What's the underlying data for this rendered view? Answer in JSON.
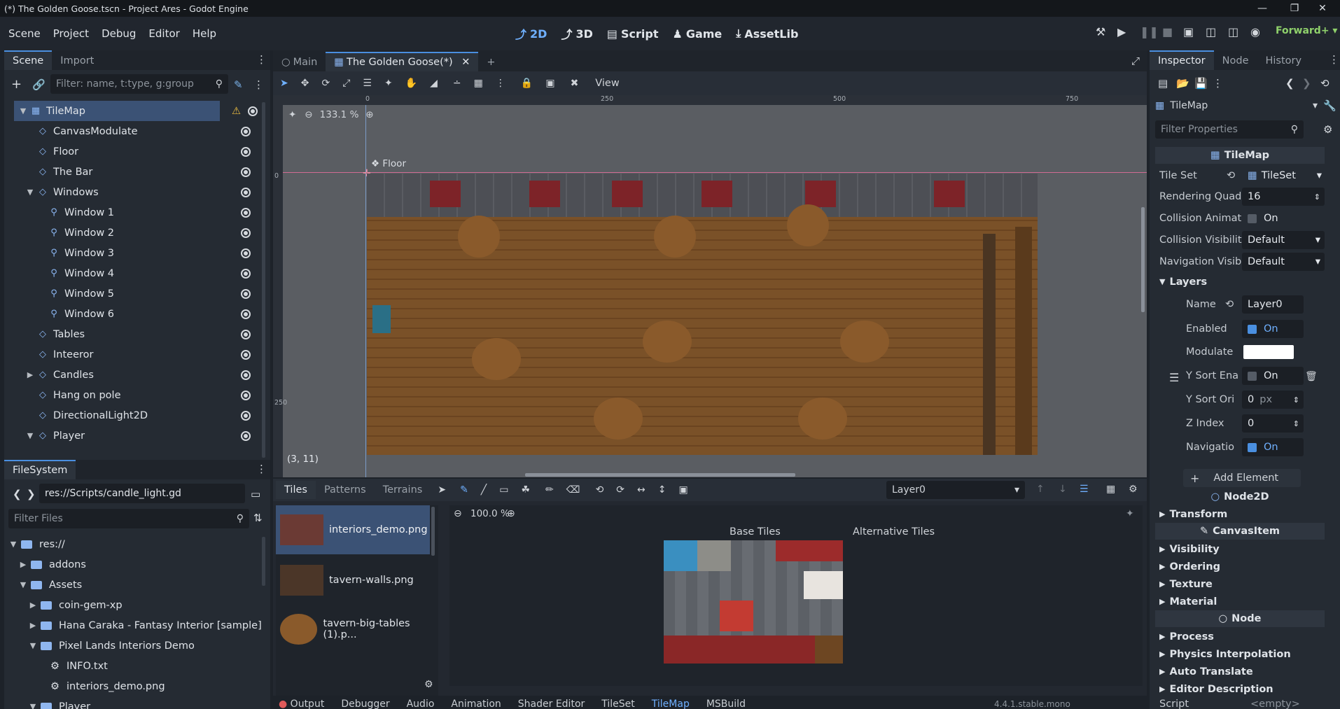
{
  "window": {
    "title": "(*) The Golden Goose.tscn - Project Ares - Godot Engine"
  },
  "menu": {
    "items": [
      "Scene",
      "Project",
      "Debug",
      "Editor",
      "Help"
    ]
  },
  "workspaces": [
    {
      "label": "2D",
      "icon": "2d-icon"
    },
    {
      "label": "3D",
      "icon": "3d-icon"
    },
    {
      "label": "Script",
      "icon": "script-icon"
    },
    {
      "label": "Game",
      "icon": "game-icon"
    },
    {
      "label": "AssetLib",
      "icon": "assetlib-icon"
    }
  ],
  "renderer": "Forward+",
  "scene_dock": {
    "tabs": [
      "Scene",
      "Import"
    ],
    "filter_placeholder": "Filter: name, t:type, g:group",
    "nodes": [
      {
        "label": "TileMap",
        "depth": 0
      },
      {
        "label": "CanvasModulate",
        "depth": 1
      },
      {
        "label": "Floor",
        "depth": 1
      },
      {
        "label": "The Bar",
        "depth": 1
      },
      {
        "label": "Windows",
        "depth": 1
      },
      {
        "label": "Window 1",
        "depth": 2
      },
      {
        "label": "Window 2",
        "depth": 2
      },
      {
        "label": "Window 3",
        "depth": 2
      },
      {
        "label": "Window 4",
        "depth": 2
      },
      {
        "label": "Window 5",
        "depth": 2
      },
      {
        "label": "Window 6",
        "depth": 2
      },
      {
        "label": "Tables",
        "depth": 1
      },
      {
        "label": "Inteeror",
        "depth": 1
      },
      {
        "label": "Candles",
        "depth": 1
      },
      {
        "label": "Hang on pole",
        "depth": 1
      },
      {
        "label": "DirectionalLight2D",
        "depth": 1
      },
      {
        "label": "Player",
        "depth": 1
      }
    ]
  },
  "filesystem": {
    "tab": "FileSystem",
    "path": "res://Scripts/candle_light.gd",
    "filter_placeholder": "Filter Files",
    "items": [
      {
        "label": "res://",
        "depth": 0
      },
      {
        "label": "addons",
        "depth": 1
      },
      {
        "label": "Assets",
        "depth": 1
      },
      {
        "label": "coin-gem-xp",
        "depth": 2
      },
      {
        "label": "Hana Caraka - Fantasy Interior [sample]",
        "depth": 2
      },
      {
        "label": "Pixel Lands Interiors Demo",
        "depth": 2
      },
      {
        "label": "INFO.txt",
        "depth": 3
      },
      {
        "label": "interiors_demo.png",
        "depth": 3
      },
      {
        "label": "Player",
        "depth": 2
      }
    ]
  },
  "editor": {
    "tabs": [
      "Main",
      "The Golden Goose(*)"
    ],
    "view_label": "View",
    "zoom": "133.1 %",
    "ruler": [
      "0",
      "250",
      "500",
      "750"
    ],
    "vruler": [
      "0",
      "250"
    ],
    "floor_label": "Floor",
    "coords": "(3, 11)"
  },
  "tile_panel": {
    "tabs": [
      "Tiles",
      "Patterns",
      "Terrains"
    ],
    "layer": "Layer0",
    "zoom": "100.0 %",
    "sources": [
      "interiors_demo.png",
      "tavern-walls.png",
      "tavern-big-tables (1).p..."
    ],
    "base_label": "Base Tiles",
    "alt_label": "Alternative Tiles"
  },
  "bottom_tabs": [
    "Output",
    "Debugger",
    "Audio",
    "Animation",
    "Shader Editor",
    "TileSet",
    "TileMap",
    "MSBuild"
  ],
  "version": "4.4.1.stable.mono",
  "inspector": {
    "tabs": [
      "Inspector",
      "Node",
      "History"
    ],
    "object": "TileMap",
    "filter_placeholder": "Filter Properties",
    "class_header": "TileMap",
    "tile_set": {
      "label": "Tile Set",
      "value": "TileSet"
    },
    "rendering_quadrant": {
      "label": "Rendering Quad",
      "value": "16"
    },
    "collision_anim": {
      "label": "Collision Animat",
      "value": "On"
    },
    "collision_vis": {
      "label": "Collision Visibilit",
      "value": "Default"
    },
    "nav_vis": {
      "label": "Navigation Visib",
      "value": "Default"
    },
    "layers_label": "Layers",
    "layer_name": {
      "label": "Name",
      "value": "Layer0"
    },
    "enabled": {
      "label": "Enabled",
      "value": "On"
    },
    "modulate": {
      "label": "Modulate"
    },
    "ysort_enabled": {
      "label": "Y Sort Ena",
      "value": "On"
    },
    "ysort_origin": {
      "label": "Y Sort Ori",
      "value": "0",
      "unit": "px"
    },
    "z_index": {
      "label": "Z Index",
      "value": "0"
    },
    "navigation": {
      "label": "Navigatio",
      "value": "On"
    },
    "add_element": "Add Element",
    "node2d": "Node2D",
    "transform": "Transform",
    "canvasitem": "CanvasItem",
    "canvas_sections": [
      "Visibility",
      "Ordering",
      "Texture",
      "Material"
    ],
    "node": "Node",
    "node_sections": [
      "Process",
      "Physics Interpolation",
      "Auto Translate",
      "Editor Description"
    ],
    "script_label": "Script",
    "script_value": "<empty>"
  },
  "colors": {
    "accent": "#4a8fe0",
    "bg": "#1d2229",
    "panel": "#252b33"
  }
}
